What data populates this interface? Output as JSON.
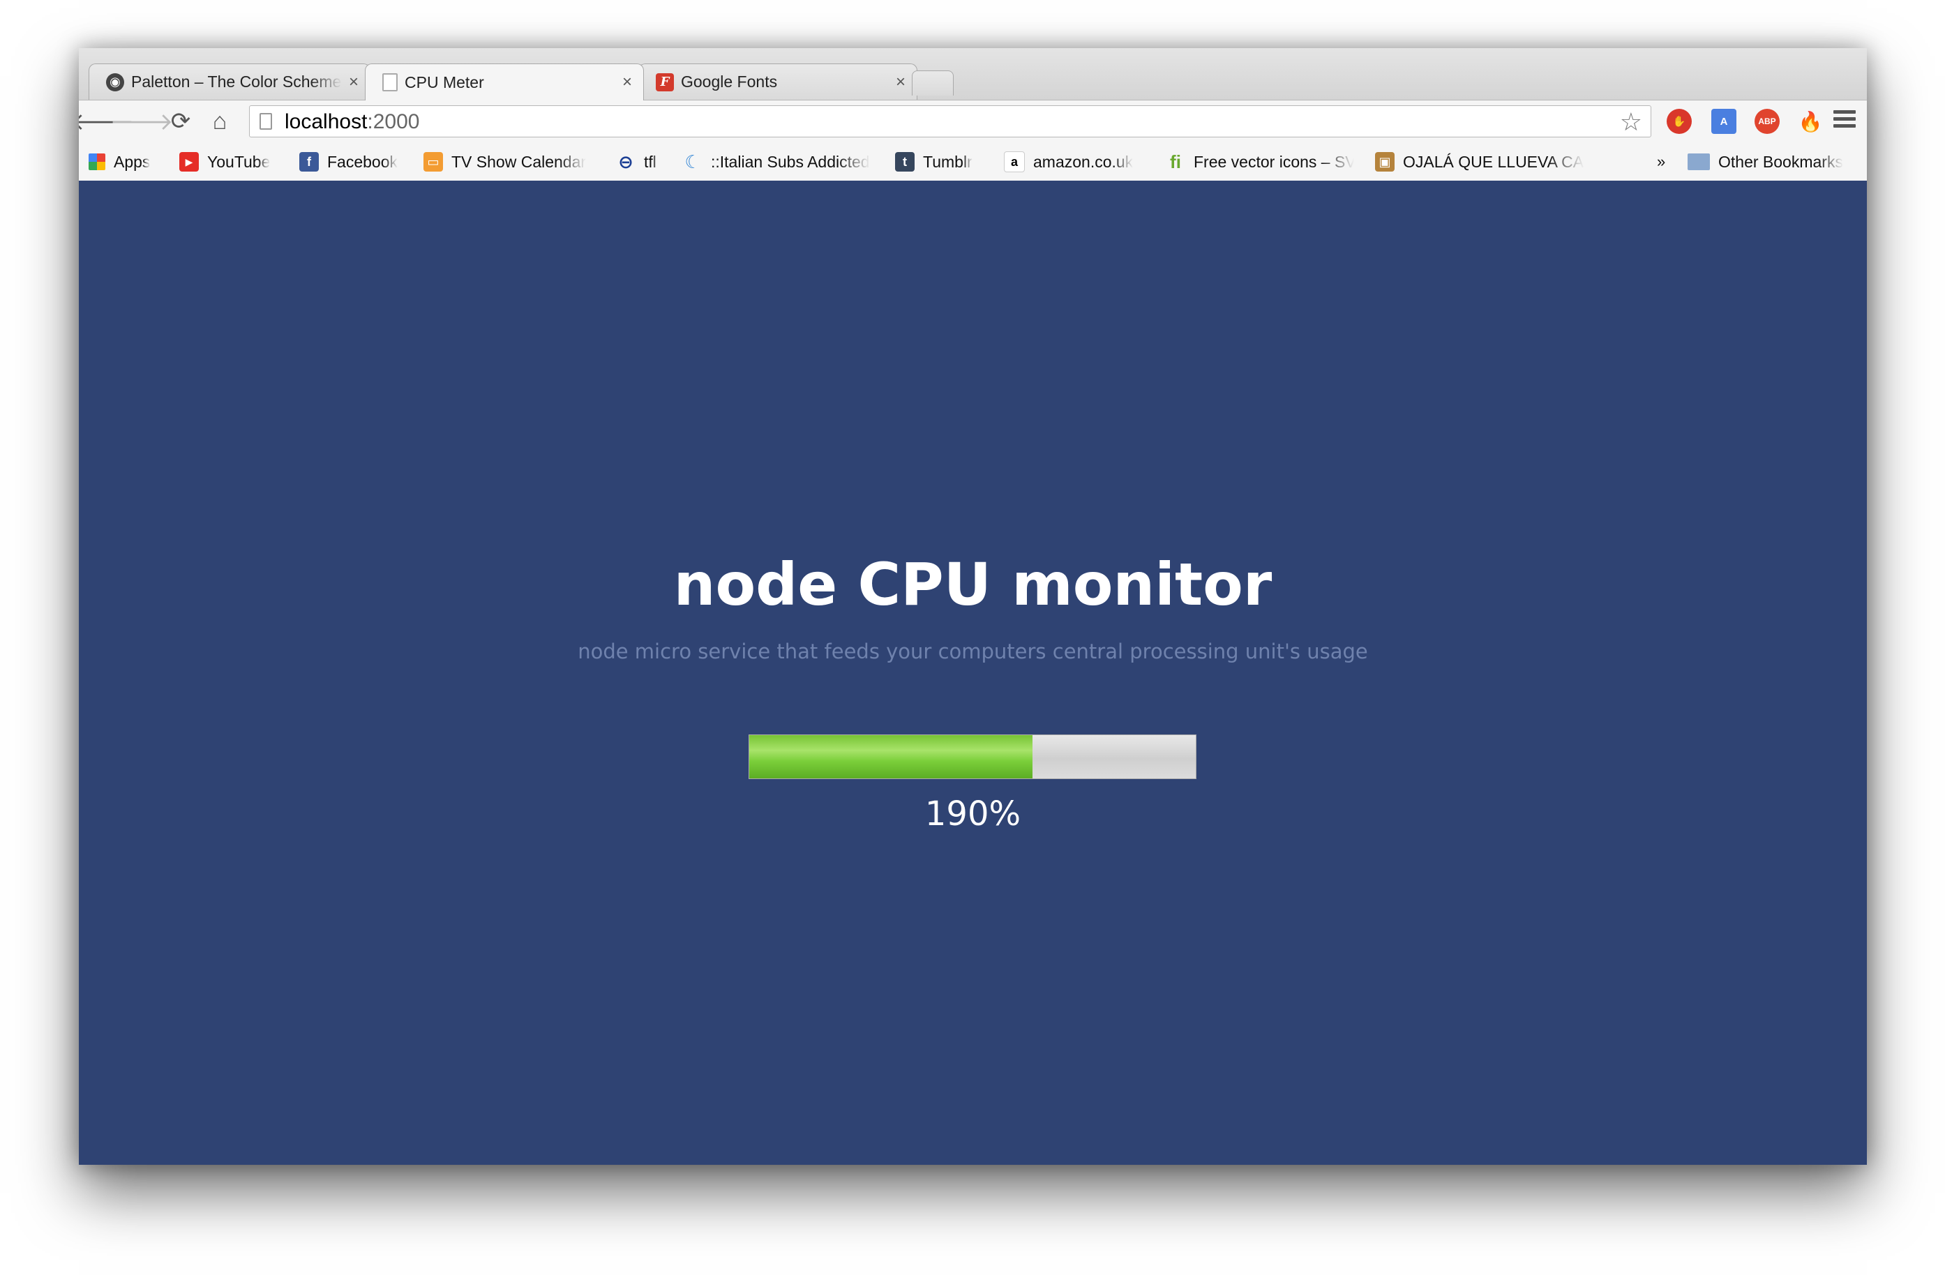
{
  "tabs": [
    {
      "title": "Paletton – The Color Scheme Designer",
      "close": "×",
      "icon": "paletton-icon",
      "active": false
    },
    {
      "title": "CPU Meter",
      "close": "×",
      "icon": "page-icon",
      "active": true
    },
    {
      "title": "Google Fonts",
      "close": "×",
      "icon": "google-fonts-icon",
      "active": false
    }
  ],
  "toolbar": {
    "url_host": "localhost",
    "url_port": ":2000",
    "back": "🡐",
    "forward": "🡒",
    "reload": "⟳",
    "home": "⌂",
    "star": "☆"
  },
  "extensions": [
    {
      "label": "✋",
      "color": "#d9372b"
    },
    {
      "label": "A",
      "color": "#4a7fe0"
    },
    {
      "label": "ABP",
      "color": "#e0442e"
    },
    {
      "label": "🔥",
      "color": "#f47a21"
    }
  ],
  "bookmarks": [
    {
      "label": "Apps",
      "icon": "apps-grid-icon"
    },
    {
      "label": "YouTube",
      "icon": "youtube-icon"
    },
    {
      "label": "Facebook",
      "icon": "facebook-icon"
    },
    {
      "label": "TV Show Calendar",
      "icon": "tv-icon"
    },
    {
      "label": "tfl",
      "icon": "tfl-roundel-icon"
    },
    {
      "label": "::Italian Subs Addicted",
      "icon": "italian-subs-icon"
    },
    {
      "label": "Tumblr",
      "icon": "tumblr-icon"
    },
    {
      "label": "amazon.co.uk",
      "icon": "amazon-icon"
    },
    {
      "label": "Free vector icons – SVG",
      "icon": "flaticon-icon"
    },
    {
      "label": "OJALÁ QUE LLUEVA CAFÉ",
      "icon": "ojala-icon"
    }
  ],
  "bookmarks_overflow": "»",
  "other_bookmarks": "Other Bookmarks",
  "page": {
    "heading": "node CPU monitor",
    "subtitle": "node micro service that feeds your computers central processing unit's usage",
    "cpu_percent_text": "190%",
    "meter_fill_fraction": 0.635,
    "meter_color": "#7bcf3a",
    "background_color": "#2f4373"
  }
}
